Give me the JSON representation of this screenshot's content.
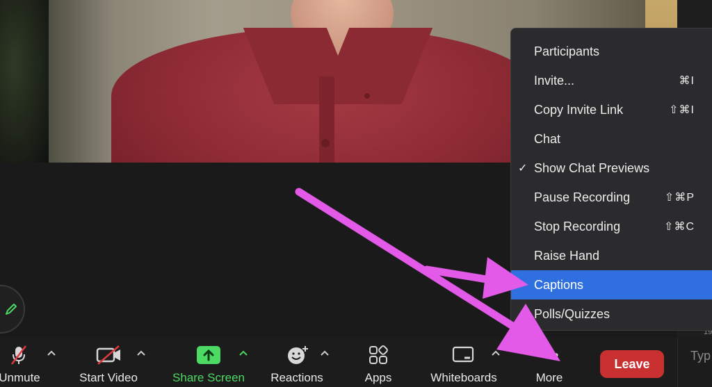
{
  "toolbar": {
    "unmute": "Unmute",
    "start_video": "Start Video",
    "share_screen": "Share Screen",
    "reactions": "Reactions",
    "apps": "Apps",
    "whiteboards": "Whiteboards",
    "more": "More",
    "leave": "Leave"
  },
  "chat_input": {
    "placeholder": "Typ"
  },
  "side_panel": {
    "partial_text": "19"
  },
  "menu": {
    "items": [
      {
        "label": "Participants",
        "shortcut": ""
      },
      {
        "label": "Invite...",
        "shortcut": "⌘I"
      },
      {
        "label": "Copy Invite Link",
        "shortcut": "⇧⌘I"
      },
      {
        "label": "Chat",
        "shortcut": ""
      },
      {
        "label": "Show Chat Previews",
        "shortcut": "",
        "checked": "✓"
      },
      {
        "label": "Pause Recording",
        "shortcut": "⇧⌘P"
      },
      {
        "label": "Stop Recording",
        "shortcut": "⇧⌘C"
      },
      {
        "label": "Raise Hand",
        "shortcut": ""
      },
      {
        "label": "Captions",
        "shortcut": "",
        "highlighted": true
      },
      {
        "label": "Polls/Quizzes",
        "shortcut": ""
      }
    ]
  },
  "colors": {
    "accent_green": "#4cd964",
    "leave_red": "#c83130",
    "menu_highlight": "#2f6fe0",
    "annotation_arrow": "#e35ae8"
  }
}
